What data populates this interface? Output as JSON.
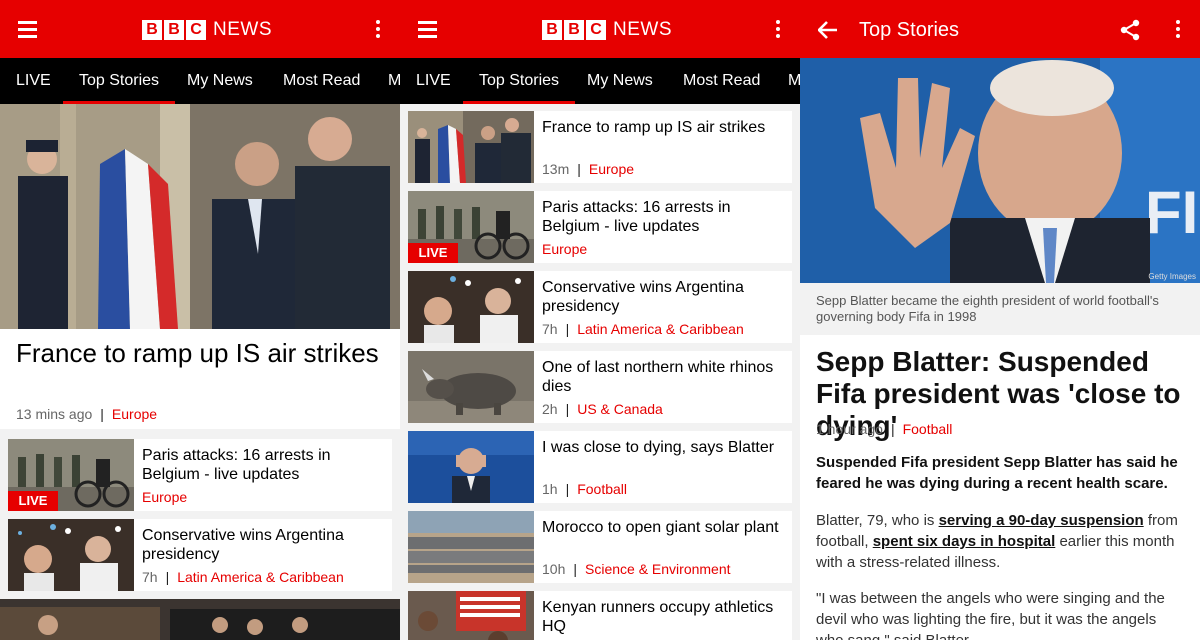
{
  "brand": {
    "letters": [
      "B",
      "B",
      "C"
    ],
    "news": "NEWS",
    "color": "#e60000"
  },
  "tabs": [
    "LIVE",
    "Top Stories",
    "My News",
    "Most Read",
    "M"
  ],
  "panel1": {
    "hero": {
      "title": "France to ramp up IS air strikes",
      "time": "13 mins ago",
      "section": "Europe"
    },
    "items": [
      {
        "title": "Paris attacks: 16 arrests in Belgium - live updates",
        "time": "",
        "section": "Europe",
        "badge": "LIVE"
      },
      {
        "title": "Conservative wins Argentina presidency",
        "time": "7h",
        "section": "Latin America & Caribbean"
      }
    ]
  },
  "panel2": {
    "items": [
      {
        "title": "France to ramp up IS air strikes",
        "time": "13m",
        "section": "Europe"
      },
      {
        "title": "Paris attacks: 16 arrests in Belgium - live updates",
        "time": "",
        "section": "Europe",
        "badge": "LIVE"
      },
      {
        "title": "Conservative wins Argentina presidency",
        "time": "7h",
        "section": "Latin America & Caribbean"
      },
      {
        "title": "One of last northern white rhinos dies",
        "time": "2h",
        "section": "US & Canada"
      },
      {
        "title": "I was close to dying, says Blatter",
        "time": "1h",
        "section": "Football"
      },
      {
        "title": "Morocco to open giant solar plant",
        "time": "10h",
        "section": "Science & Environment"
      },
      {
        "title": "Kenyan runners occupy athletics HQ",
        "time": "",
        "section": ""
      }
    ]
  },
  "panel3": {
    "appbar_title": "Top Stories",
    "image_credit": "Getty Images",
    "caption": "Sepp Blatter became the eighth president of world football's governing body Fifa in 1998",
    "headline": "Sepp Blatter: Suspended Fifa president was 'close to dying'",
    "time": "1 hour ago",
    "section": "Football",
    "lead": "Suspended Fifa president Sepp Blatter has said he feared he was dying during a recent health scare.",
    "para1": {
      "t1": "Blatter, 79, who is ",
      "link1": "serving a 90-day suspension",
      "t2": " from football, ",
      "link2": "spent six days in hospital",
      "t3": " earlier this month with a stress-related illness."
    },
    "para2": "\"I was between the angels who were singing and the devil who was lighting the fire, but it was the angels who sang,\" said Blatter."
  }
}
